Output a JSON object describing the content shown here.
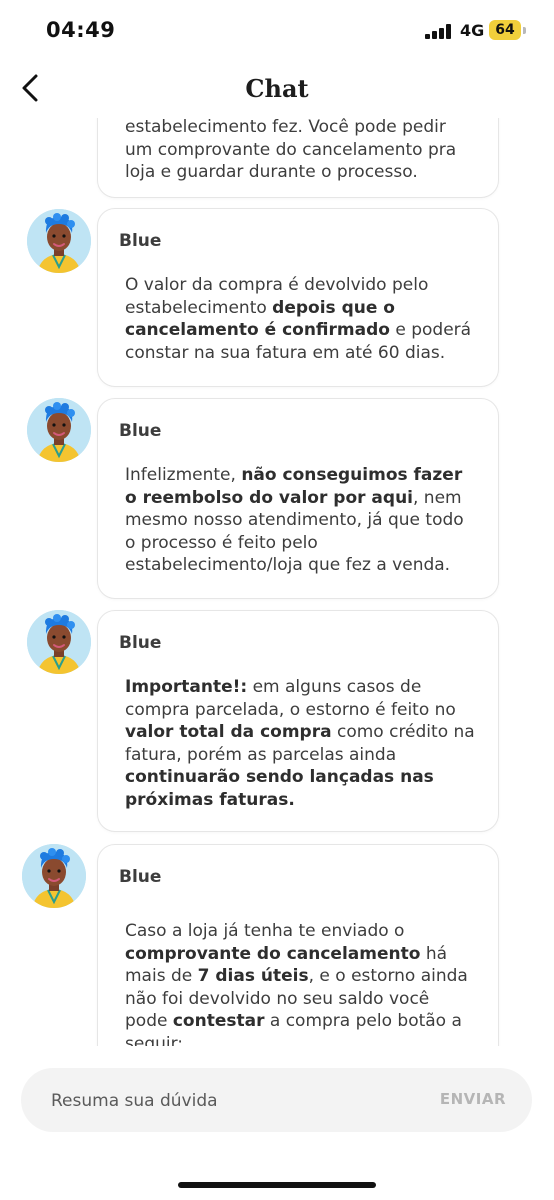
{
  "status_bar": {
    "time": "04:49",
    "network": "4G",
    "battery": "64",
    "battery_color": "#f1cf3b"
  },
  "header": {
    "title": "Chat",
    "back_icon": "chevron-left-icon"
  },
  "messages": [
    {
      "sender": "",
      "html": "estabelecimento fez. Você pode pedir um comprovante do cancelamento pra loja e guardar durante o processo."
    },
    {
      "sender": "Blue",
      "html": "O valor da compra é devolvido pelo estabelecimento <b>depois que o cancelamento é confirmado</b> e poderá constar na sua fatura em até 60 dias."
    },
    {
      "sender": "Blue",
      "html": "Infelizmente, <b>não conseguimos fazer o reembolso do valor por aqui</b>, nem mesmo nosso atendimento, já que todo o processo é feito pelo estabelecimento/loja que fez a venda."
    },
    {
      "sender": "Blue",
      "html": "<b>Importante!:</b> em alguns casos de compra parcelada, o estorno é feito no <b>valor total da compra</b> como crédito na fatura, porém as parcelas ainda <b>continuarão sendo lançadas nas próximas faturas.</b>"
    },
    {
      "sender": "Blue",
      "html": "Caso a loja já tenha te enviado o <b>comprovante do cancelamento</b> há mais de <b>7 dias úteis</b>, e o estorno ainda não foi devolvido no seu saldo você pode <b>contestar</b> a compra pelo botão a seguir:"
    }
  ],
  "composer": {
    "placeholder": "Resuma sua dúvida",
    "send_label": "ENVIAR"
  }
}
